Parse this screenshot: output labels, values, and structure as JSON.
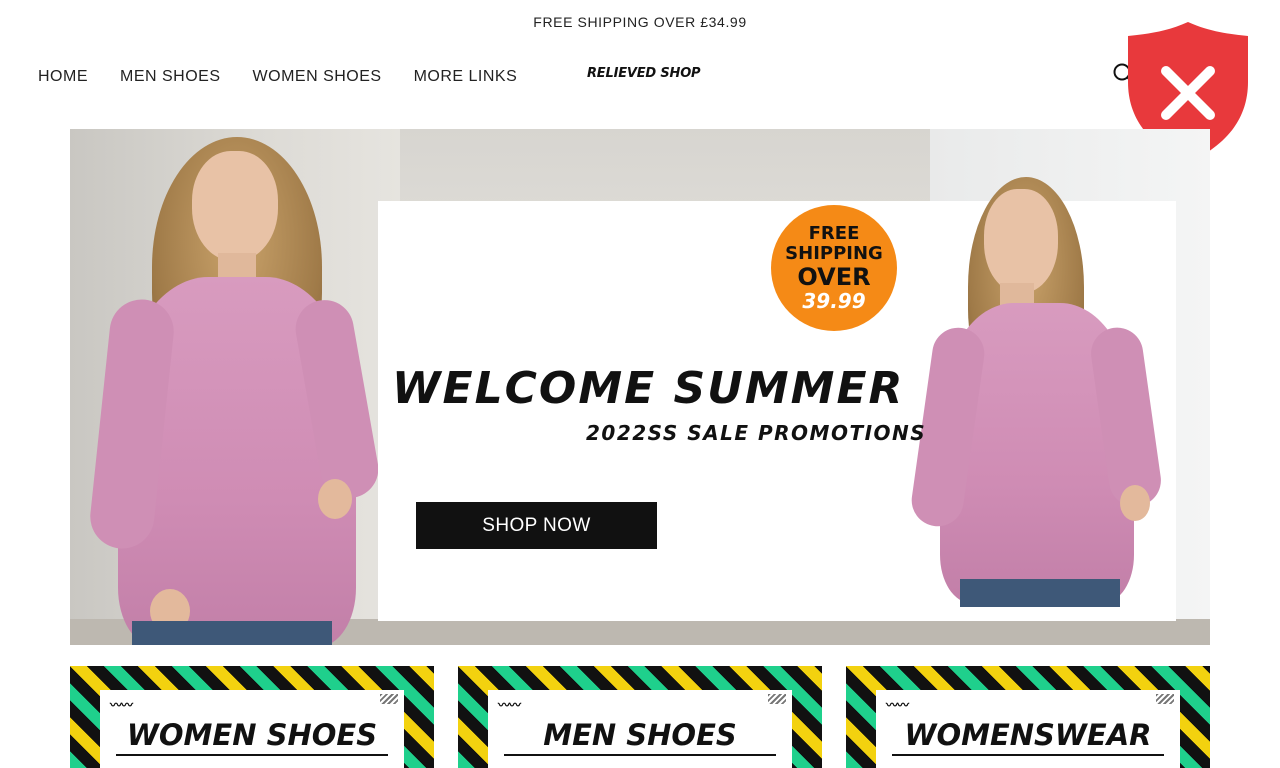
{
  "announcement": {
    "text": "FREE SHIPPING OVER  £34.99"
  },
  "nav": {
    "items": [
      {
        "label": "HOME"
      },
      {
        "label": "MEN SHOES"
      },
      {
        "label": "WOMEN SHOES"
      },
      {
        "label": "MORE LINKS"
      }
    ]
  },
  "logo": {
    "text": "RELIEVED SHOP"
  },
  "header_icons": {
    "search": "search-icon",
    "overlay": "shield-close-icon"
  },
  "hero": {
    "badge": {
      "line1": "FREE",
      "line2": "SHIPPING",
      "line3": "OVER",
      "line4": "39.99"
    },
    "headline": "WELCOME SUMMER",
    "subhead": "2022SS SALE PROMOTIONS",
    "button": "SHOP NOW"
  },
  "categories": [
    {
      "label": "WOMEN SHOES"
    },
    {
      "label": "MEN SHOES"
    },
    {
      "label": "WOMENSWEAR"
    }
  ],
  "colors": {
    "shield": "#e8393c",
    "badge": "#f58a16",
    "shirt": "#d89bbf",
    "stripe_green": "#1fd08c",
    "stripe_yellow": "#f3d20f"
  }
}
